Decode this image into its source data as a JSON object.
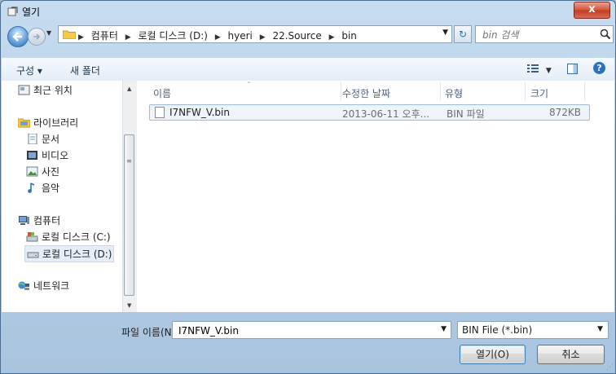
{
  "window": {
    "title": "열기",
    "close_label": "x"
  },
  "navigation": {
    "breadcrumbs": [
      "컴퓨터",
      "로컬 디스크 (D:)",
      "hyeri",
      "22.Source",
      "bin"
    ],
    "search_placeholder": "bin 검색"
  },
  "toolbar": {
    "organize_label": "구성 ▾",
    "new_folder_label": "새 폴더",
    "help_label": "?"
  },
  "sidebar": {
    "items": [
      {
        "label": "최근 위치",
        "icon": "recent-places-icon"
      },
      {
        "label": "라이브러리",
        "icon": "libraries-icon"
      },
      {
        "label": "문서",
        "icon": "documents-icon"
      },
      {
        "label": "비디오",
        "icon": "videos-icon"
      },
      {
        "label": "사진",
        "icon": "pictures-icon"
      },
      {
        "label": "음악",
        "icon": "music-icon"
      },
      {
        "label": "컴퓨터",
        "icon": "computer-icon"
      },
      {
        "label": "로컬 디스크 (C:)",
        "icon": "drive-c-icon"
      },
      {
        "label": "로컬 디스크 (D:)",
        "icon": "drive-d-icon",
        "selected": true
      },
      {
        "label": "네트워크",
        "icon": "network-icon"
      }
    ]
  },
  "filelist": {
    "columns": [
      "이름",
      "수정한 날짜",
      "유형",
      "크기"
    ],
    "rows": [
      {
        "name": "I7NFW_V.bin",
        "modified": "2013-06-11 오후...",
        "type": "BIN 파일",
        "size": "872KB"
      }
    ]
  },
  "bottom": {
    "filename_label": "파일 이름(N):",
    "filename_value": "I7NFW_V.bin",
    "filetype_value": "BIN File (*.bin)",
    "open_label": "열기(O)",
    "cancel_label": "취소"
  },
  "colors": {
    "accent": "#2f6fbd",
    "selection_bg": "#eef4fa",
    "frame": "#b6cfe6"
  }
}
